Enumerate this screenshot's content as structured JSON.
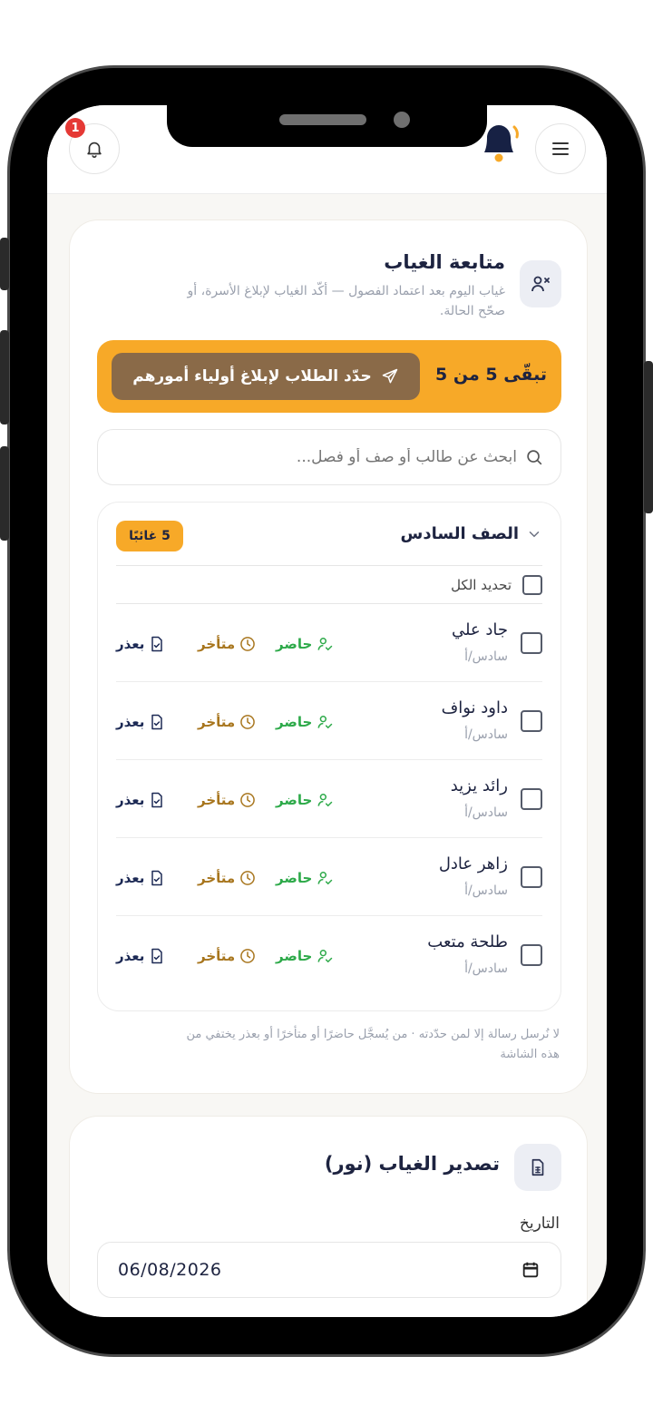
{
  "header": {
    "notification_count": "1"
  },
  "absence": {
    "title": "متابعة الغياب",
    "subtitle_line1": "غياب اليوم بعد اعتماد الفصول — أكّد الغياب لإبلاغ الأسرة، أو",
    "subtitle_line2": "صحّح الحالة.",
    "remaining_label": "تبقّى 5 من 5",
    "select_button_label": "حدّد الطلاب لإبلاغ أولياء أمورهم",
    "search_placeholder": "ابحث عن طالب أو صف أو فصل...",
    "group": {
      "name": "الصف السادس",
      "absent_badge": "5 غائبًا",
      "select_all_label": "تحديد الكل",
      "students": [
        {
          "name": "جاد علي",
          "class": "سادس/أ"
        },
        {
          "name": "داود نواف",
          "class": "سادس/أ"
        },
        {
          "name": "رائد يزيد",
          "class": "سادس/أ"
        },
        {
          "name": "زاهر عادل",
          "class": "سادس/أ"
        },
        {
          "name": "طلحة متعب",
          "class": "سادس/أ"
        }
      ],
      "status_labels": {
        "present": "حاضر",
        "late": "متأخر",
        "excused": "بعذر"
      }
    },
    "footnote_line1": "لا نُرسل رسالة إلا لمن حدّدته · من يُسجَّل حاضرًا أو متأخرًا أو بعذر يختفي من",
    "footnote_line2": "هذه الشاشة"
  },
  "export": {
    "title": "تصدير الغياب (نور)",
    "date_label": "التاريخ",
    "date_value": "06/08/2026"
  },
  "colors": {
    "accent": "#f7a928",
    "select_button": "#8a6a48",
    "present": "#2eaa4a",
    "late": "#a8761e",
    "excused": "#1d2a55",
    "bell": "#172144"
  }
}
